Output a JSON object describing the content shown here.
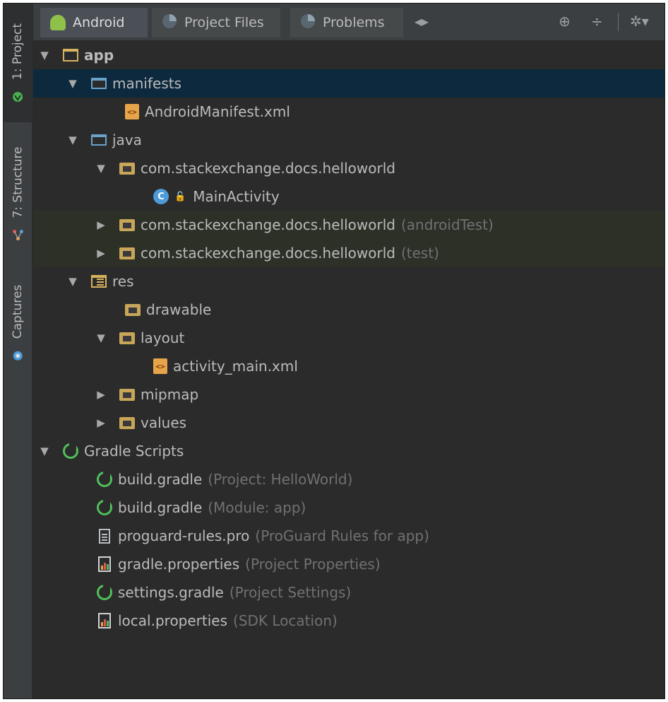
{
  "side_tabs": [
    {
      "label": "1: Project",
      "icon": "android-project-icon"
    },
    {
      "label": "7: Structure",
      "icon": "structure-icon"
    },
    {
      "label": "Captures",
      "icon": "captures-icon"
    }
  ],
  "tabs": [
    {
      "label": "Android",
      "icon": "android-icon"
    },
    {
      "label": "Project Files",
      "icon": "project-files-icon"
    },
    {
      "label": "Problems",
      "icon": "problems-icon"
    }
  ],
  "toolbar": {
    "scroll_arrows": "◂▸",
    "target": "⊕",
    "collapse": "÷",
    "settings": "✲▾"
  },
  "tree": {
    "app": "app",
    "manifests": "manifests",
    "android_manifest": "AndroidManifest.xml",
    "java": "java",
    "pkg_main": "com.stackexchange.docs.helloworld",
    "main_activity": "MainActivity",
    "pkg_android_test": "com.stackexchange.docs.helloworld",
    "pkg_android_test_note": "(androidTest)",
    "pkg_test": "com.stackexchange.docs.helloworld",
    "pkg_test_note": "(test)",
    "res": "res",
    "drawable": "drawable",
    "layout": "layout",
    "activity_main": "activity_main.xml",
    "mipmap": "mipmap",
    "values": "values",
    "gradle_scripts": "Gradle Scripts",
    "build_gradle_project": "build.gradle",
    "build_gradle_project_note": "(Project: HelloWorld)",
    "build_gradle_module": "build.gradle",
    "build_gradle_module_note": "(Module: app)",
    "proguard": "proguard-rules.pro",
    "proguard_note": "(ProGuard Rules for app)",
    "gradle_properties": "gradle.properties",
    "gradle_properties_note": "(Project Properties)",
    "settings_gradle": "settings.gradle",
    "settings_gradle_note": "(Project Settings)",
    "local_properties": "local.properties",
    "local_properties_note": "(SDK Location)"
  },
  "colors": {
    "background": "#2b2b2b",
    "selection": "#0d293e",
    "text": "#bbbbbb",
    "hint": "#6f7173"
  }
}
